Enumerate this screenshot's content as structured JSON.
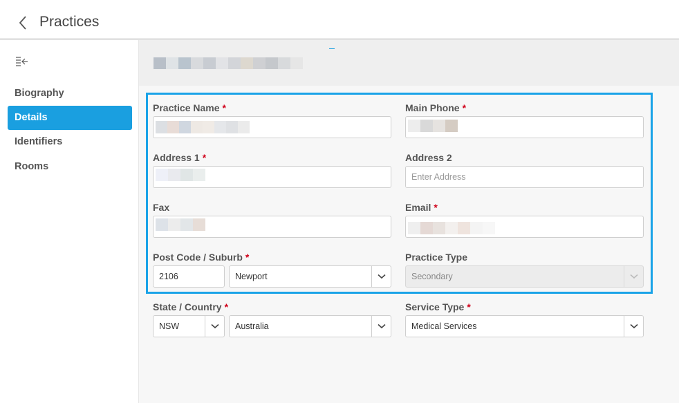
{
  "header": {
    "title": "Practices"
  },
  "sidebar": {
    "items": [
      {
        "label": "Biography"
      },
      {
        "label": "Details"
      },
      {
        "label": "Identifiers"
      },
      {
        "label": "Rooms"
      }
    ]
  },
  "form": {
    "practice_name": {
      "label": "Practice Name",
      "required": "*"
    },
    "main_phone": {
      "label": "Main Phone",
      "required": "*"
    },
    "address1": {
      "label": "Address 1",
      "required": "*"
    },
    "address2": {
      "label": "Address 2",
      "placeholder": "Enter Address"
    },
    "fax": {
      "label": "Fax"
    },
    "email": {
      "label": "Email",
      "required": "*"
    },
    "postcode_suburb": {
      "label": "Post Code / Suburb",
      "required": "*",
      "postcode": "2106",
      "suburb": "Newport"
    },
    "practice_type": {
      "label": "Practice Type",
      "value": "Secondary"
    },
    "state_country": {
      "label": "State / Country",
      "required": "*",
      "state": "NSW",
      "country": "Australia"
    },
    "service_type": {
      "label": "Service Type",
      "required": "*",
      "value": "Medical Services"
    }
  },
  "colors": {
    "accent": "#1a9fe0",
    "highlight_border": "#1aa3e8",
    "required": "#d0021b"
  },
  "icons": {
    "back": "chevron-left-icon",
    "collapse": "collapse-menu-icon",
    "dropdown": "chevron-down-icon"
  }
}
